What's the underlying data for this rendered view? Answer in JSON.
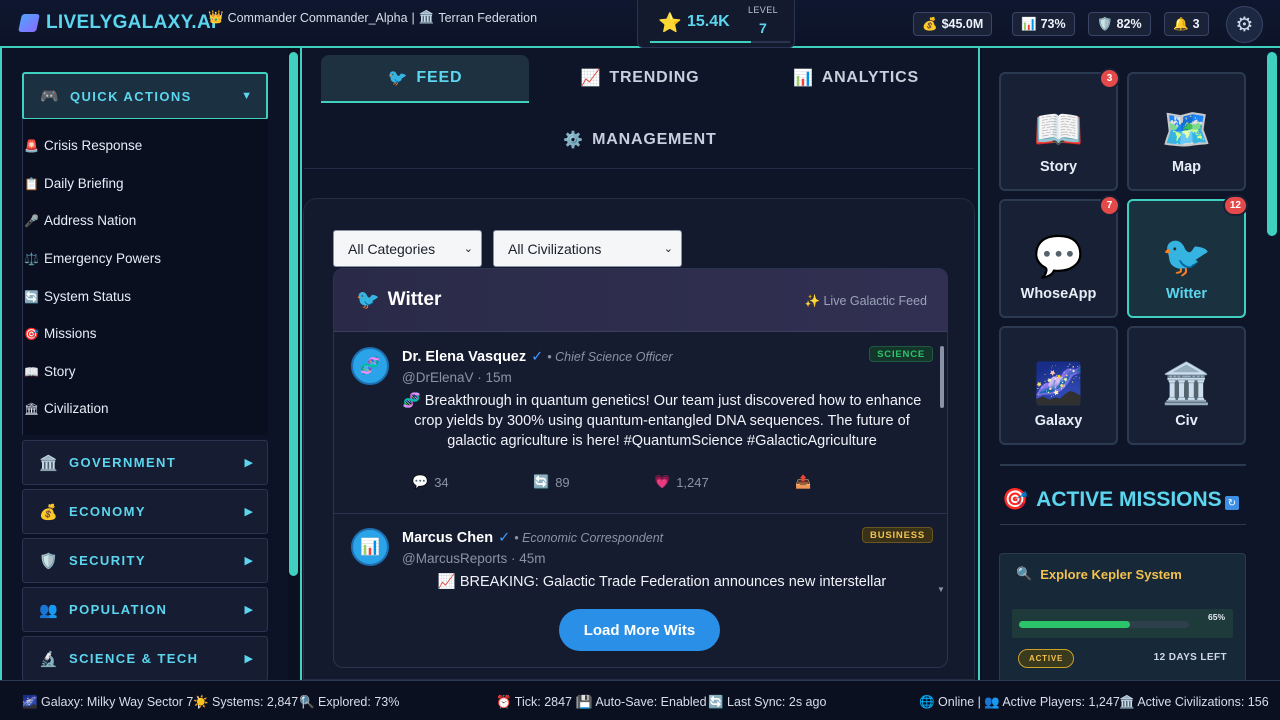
{
  "header": {
    "brand": "LIVELYGALAXY.AI",
    "commander_icon": "crown-icon",
    "commander": "Commander Commander_Alpha",
    "faction": "Terran Federation",
    "xp_value": "15.4K",
    "level_label": "LEVEL",
    "level": "7",
    "xp_progress": 0.72,
    "stats": [
      {
        "icon": "money-bag-icon",
        "glyph": "💰",
        "value": "$45.0M"
      },
      {
        "icon": "chart-icon",
        "glyph": "📊",
        "value": "73%"
      },
      {
        "icon": "shield-icon",
        "glyph": "🛡️",
        "value": "82%"
      },
      {
        "icon": "bell-icon",
        "glyph": "🔔",
        "value": "3"
      }
    ]
  },
  "sidebar": {
    "quick_actions": {
      "label": "QUICK ACTIONS",
      "items": [
        {
          "icon": "siren",
          "glyph": "🚨",
          "label": "Crisis Response"
        },
        {
          "icon": "clipboard",
          "glyph": "📋",
          "label": "Daily Briefing"
        },
        {
          "icon": "microphone",
          "glyph": "🎤",
          "label": "Address Nation"
        },
        {
          "icon": "scales",
          "glyph": "⚖️",
          "label": "Emergency Powers"
        },
        {
          "icon": "refresh",
          "glyph": "🔄",
          "label": "System Status"
        },
        {
          "icon": "target",
          "glyph": "🎯",
          "label": "Missions"
        },
        {
          "icon": "book",
          "glyph": "📖",
          "label": "Story"
        },
        {
          "icon": "building",
          "glyph": "🏛",
          "label": "Civilization"
        }
      ]
    },
    "sections": [
      {
        "glyph": "🏛️",
        "label": "GOVERNMENT"
      },
      {
        "glyph": "💰",
        "label": "ECONOMY"
      },
      {
        "glyph": "🛡️",
        "label": "SECURITY"
      },
      {
        "glyph": "👥",
        "label": "POPULATION"
      },
      {
        "glyph": "🔬",
        "label": "SCIENCE & TECH"
      }
    ]
  },
  "tabs": [
    {
      "glyph": "🐦",
      "label": "FEED",
      "active": true
    },
    {
      "glyph": "📈",
      "label": "TRENDING"
    },
    {
      "glyph": "📊",
      "label": "ANALYTICS"
    },
    {
      "glyph": "⚙️",
      "label": "MANAGEMENT"
    }
  ],
  "filters": {
    "category": "All Categories",
    "civilization": "All Civilizations"
  },
  "feed": {
    "title": "Witter",
    "live_label": "✨ Live Galactic Feed",
    "posts": [
      {
        "avatar": "🧬",
        "name": "Dr. Elena Vasquez",
        "verified": "✓",
        "role": "• Chief Science Officer",
        "handle": "@DrElenaV",
        "time": "· 15m",
        "badge": "SCIENCE",
        "text": "🧬 Breakthrough in quantum genetics! Our team just discovered how to enhance crop yields by 300% using quantum-entangled DNA sequences. The future of galactic agriculture is here! #QuantumScience #GalacticAgriculture",
        "replies": "34",
        "rewits": "89",
        "likes": "1,247"
      },
      {
        "avatar": "📊",
        "name": "Marcus Chen",
        "verified": "✓",
        "role": "• Economic Correspondent",
        "handle": "@MarcusReports",
        "time": "· 45m",
        "badge": "BUSINESS",
        "text": "📈 BREAKING: Galactic Trade Federation announces new interstellar"
      }
    ],
    "load_more": "Load More Wits"
  },
  "apps": [
    {
      "glyph": "📖",
      "label": "Story",
      "badge": "3"
    },
    {
      "glyph": "🗺️",
      "label": "Map"
    },
    {
      "glyph": "💬",
      "label": "WhoseApp",
      "badge": "7"
    },
    {
      "glyph": "🐦",
      "label": "Witter",
      "badge": "12",
      "active": true
    },
    {
      "glyph": "🌌",
      "label": "Galaxy"
    },
    {
      "glyph": "🏛️",
      "label": "Civ"
    }
  ],
  "missions": {
    "title": "ACTIVE MISSIONS",
    "items": [
      {
        "name": "Explore Kepler System",
        "progress": 65,
        "progress_label": "65%",
        "status": "ACTIVE",
        "days_left": "12 DAYS LEFT"
      }
    ]
  },
  "footer": {
    "galaxy": "🌌 Galaxy: Milky Way Sector 7 |",
    "systems": "☀️ Systems: 2,847 |",
    "explored": "🔍 Explored: 73%",
    "tick": "⏰ Tick: 2847 |",
    "autosave": "💾 Auto-Save: Enabled |",
    "sync": "🔄 Last Sync: 2s ago",
    "online": "🌐 Online |",
    "players": "👥 Active Players: 1,247 |",
    "civs": "🏛️ Active Civilizations: 156"
  },
  "colors": {
    "accent": "#3fd0c0",
    "brand": "#5cd6ee",
    "science_badge": "#2bc46a",
    "business_badge": "#f2c14e",
    "notification": "#e44a4a"
  }
}
